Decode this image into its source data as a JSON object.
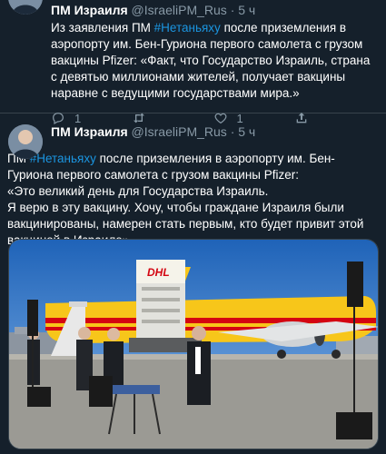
{
  "tweets": [
    {
      "author_name": "ПМ Израиля",
      "author_handle": "@IsraeliPM_Rus",
      "separator": "·",
      "time": "5 ч",
      "text_before": "Из заявления ПМ ",
      "hashtag": "#Нетаньяху",
      "text_after": " после приземления в аэропорту им. Бен-Гуриона первого самолета с грузом вакцины Pfizer: «Факт, что Государство Израиль, страна с девятью миллионами жителей, получает вакцины наравне с ведущими государствами мира.»",
      "replies": "1",
      "retweets": "",
      "likes": "1"
    },
    {
      "author_name": "ПМ Израиля",
      "author_handle": "@IsraeliPM_Rus",
      "separator": "·",
      "time": "5 ч",
      "text_line_1_before": "ПМ ",
      "hashtag": "#Нетаньяху",
      "text_line_1_after": " после приземления в аэропорту им. Бен-Гуриона первого самолета с грузом вакцины Pfizer:",
      "text_line_2": "«Это великий день для Государства Израиль.",
      "text_line_3": "Я верю в эту вакцину. Хочу, чтобы граждане Израиля были вакцинированы, намерен стать первым, кто будет привит этой вакциной в Израиле».",
      "photo_logo": "DHL"
    }
  ],
  "colors": {
    "background": "#15202b",
    "hashtag": "#1b95e0",
    "secondary_text": "#8899a6",
    "divider": "#38444d",
    "dhl_yellow": "#f7c61a",
    "dhl_red": "#d40511"
  },
  "icons": [
    "reply-icon",
    "retweet-icon",
    "like-icon",
    "share-icon"
  ]
}
